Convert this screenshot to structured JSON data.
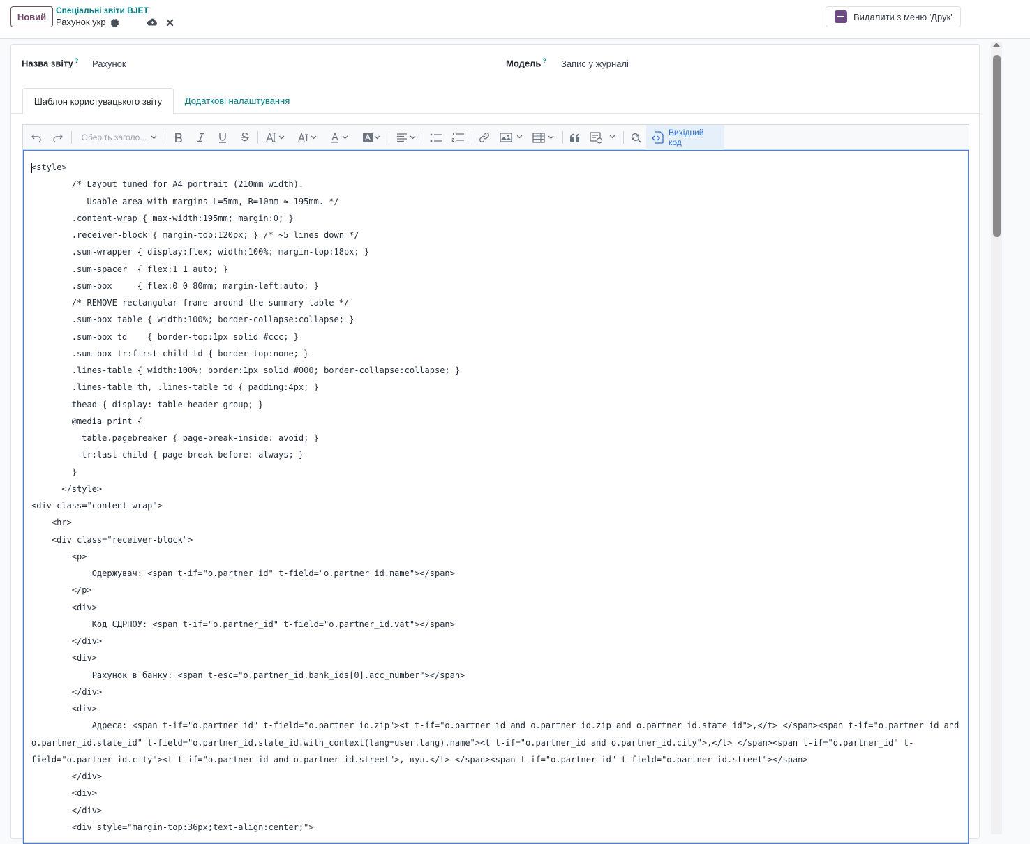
{
  "control_panel": {
    "new_label": "Новий",
    "breadcrumb_parent": "Спеціальні звіти BJET",
    "breadcrumb_current": "Рахунок укр",
    "print_menu_label": "Видалити з меню 'Друк'"
  },
  "form": {
    "report_name_label": "Назва звіту",
    "report_name_value": "Рахунок",
    "model_label": "Модель",
    "model_value": "Запис у журналі",
    "help_mark": "?"
  },
  "tabs": [
    {
      "label": "Шаблон користувацького звіту",
      "active": true
    },
    {
      "label": "Додаткові налаштування",
      "active": false
    }
  ],
  "toolbar": {
    "heading_placeholder": "Оберіть заголо...",
    "source_code_label": "Вихідний код"
  },
  "code_lines": [
    "<style>",
    "        /* Layout tuned for A4 portrait (210mm width).",
    "           Usable area with margins L=5mm, R=10mm ≈ 195mm. */",
    "        .content-wrap { max-width:195mm; margin:0; }",
    "        .receiver-block { margin-top:120px; } /* ~5 lines down */",
    "        .sum-wrapper { display:flex; width:100%; margin-top:18px; }",
    "        .sum-spacer  { flex:1 1 auto; }",
    "        .sum-box     { flex:0 0 80mm; margin-left:auto; }",
    "        /* REMOVE rectangular frame around the summary table */",
    "        .sum-box table { width:100%; border-collapse:collapse; }",
    "        .sum-box td    { border-top:1px solid #ccc; }",
    "        .sum-box tr:first-child td { border-top:none; }",
    "        .lines-table { width:100%; border:1px solid #000; border-collapse:collapse; }",
    "        .lines-table th, .lines-table td { padding:4px; }",
    "        thead { display: table-header-group; }",
    "        @media print {",
    "          table.pagebreaker { page-break-inside: avoid; }",
    "          tr:last-child { page-break-before: always; }",
    "        }",
    "      </style>",
    "<div class=\"content-wrap\">",
    "    <hr>",
    "    <div class=\"receiver-block\">",
    "        <p>",
    "            Одержувач: <span t-if=\"o.partner_id\" t-field=\"o.partner_id.name\"></span>",
    "        </p>",
    "        <div>",
    "            Код ЄДРПОУ: <span t-if=\"o.partner_id\" t-field=\"o.partner_id.vat\"></span>",
    "        </div>",
    "        <div>",
    "            Рахунок в банку: <span t-esc=\"o.partner_id.bank_ids[0].acc_number\"></span>",
    "        </div>",
    "        <div>",
    "            Адреса: <span t-if=\"o.partner_id\" t-field=\"o.partner_id.zip\"><t t-if=\"o.partner_id and o.partner_id.zip and o.partner_id.state_id\">,</t> </span><span t-if=\"o.partner_id and",
    "o.partner_id.state_id\" t-field=\"o.partner_id.state_id.with_context(lang=user.lang).name\"><t t-if=\"o.partner_id and o.partner_id.city\">,</t> </span><span t-if=\"o.partner_id\" t-",
    "field=\"o.partner_id.city\"><t t-if=\"o.partner_id and o.partner_id.street\">, вул.</t> </span><span t-if=\"o.partner_id\" t-field=\"o.partner_id.street\"></span>",
    "        </div>",
    "        <div>",
    "        </div>",
    "        <div style=\"margin-top:36px;text-align:center;\">"
  ],
  "colors": {
    "accent": "#714b67",
    "link": "#017e84",
    "source_button": "#2a6fd1"
  }
}
